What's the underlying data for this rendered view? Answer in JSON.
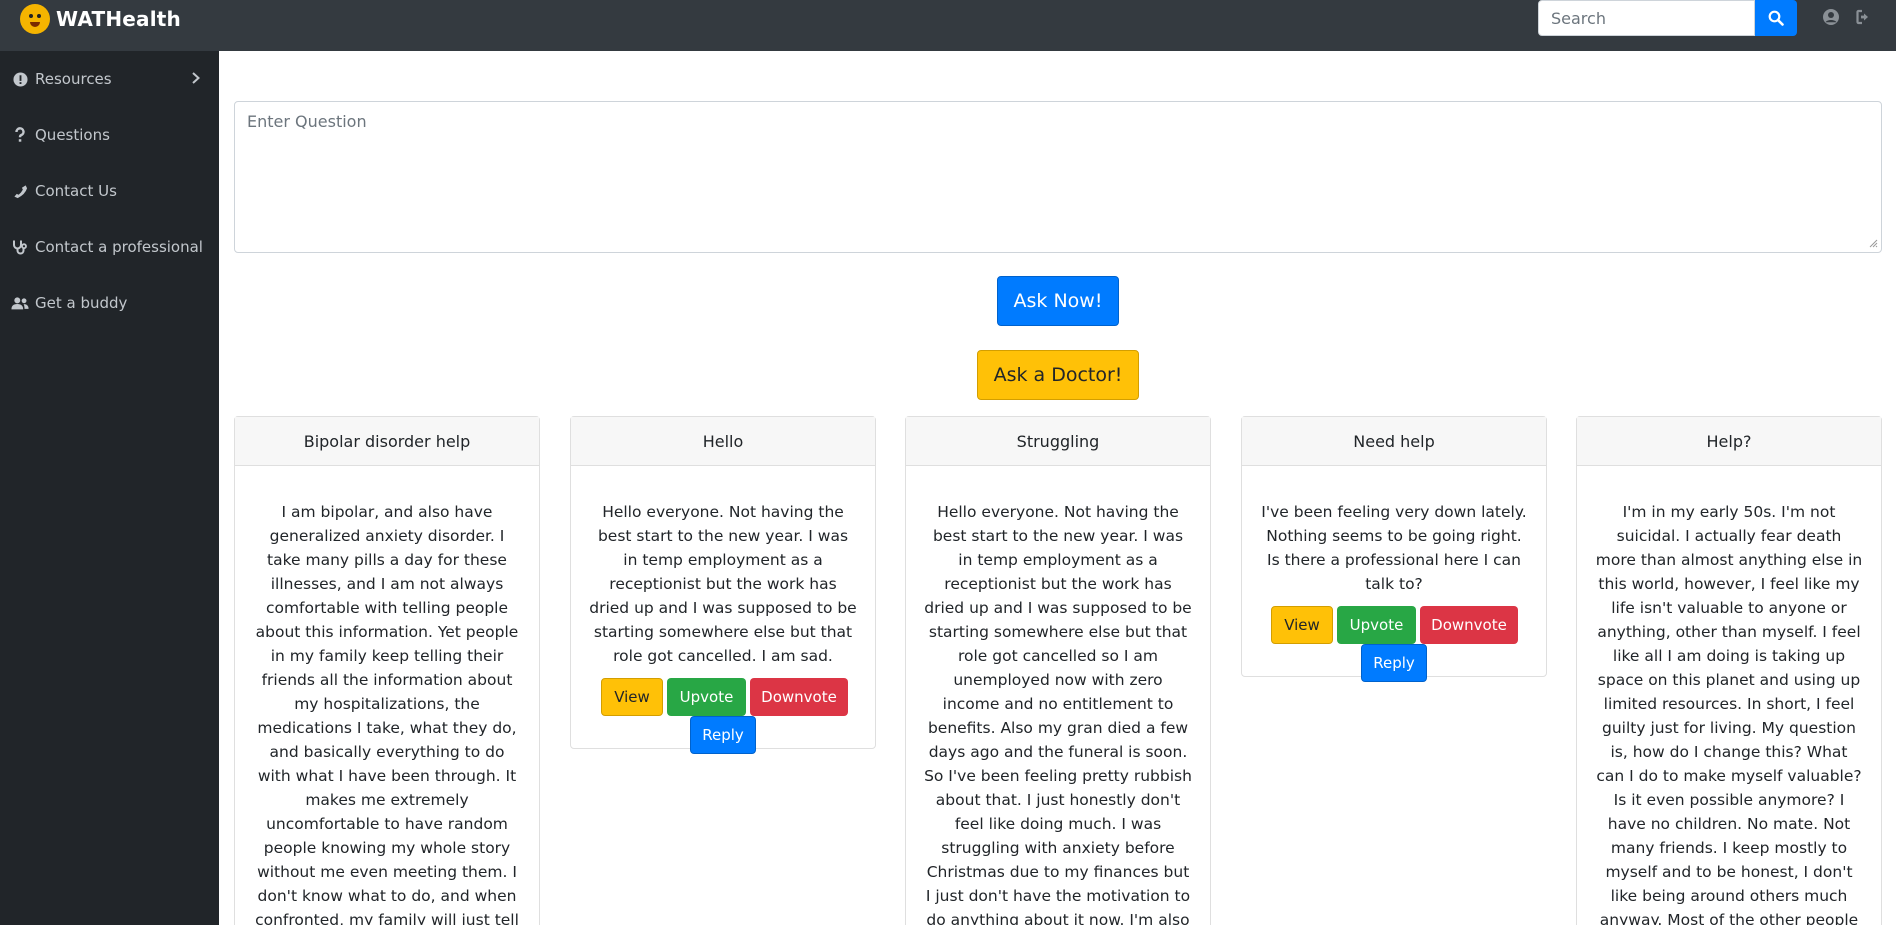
{
  "brand": {
    "name": "WATHealth",
    "logo_icon": "smiley-logo-icon"
  },
  "search": {
    "placeholder": "Search"
  },
  "sidebar": {
    "items": [
      {
        "label": "Resources",
        "icon": "exclamation-circle-icon"
      },
      {
        "label": "Questions",
        "icon": "question-icon"
      },
      {
        "label": "Contact Us",
        "icon": "phone-icon"
      },
      {
        "label": "Contact a professional",
        "icon": "stethoscope-icon"
      },
      {
        "label": "Get a buddy",
        "icon": "users-icon"
      }
    ]
  },
  "question_form": {
    "placeholder": "Enter Question",
    "ask_now_label": "Ask Now!",
    "ask_doctor_label": "Ask a Doctor!"
  },
  "post_actions": {
    "view": "View",
    "upvote": "Upvote",
    "downvote": "Downvote",
    "reply": "Reply"
  },
  "posts": [
    {
      "title": "Bipolar disorder help",
      "body": "I am bipolar, and also have generalized anxiety disorder. I take many pills a day for these illnesses, and I am not always comfortable with telling people about this information. Yet people in my family keep telling their friends all the information about my hospitalizations, the medications I take, what they do, and basically everything to do with what I have been through. It makes me extremely uncomfortable to have random people knowing my whole story without me even meeting them. I don't know what to do, and when confronted, my family will just tell"
    },
    {
      "title": "Hello",
      "body": "Hello everyone. Not having the best start to the new year. I was in temp employment as a receptionist but the work has dried up and I was supposed to be starting somewhere else but that role got cancelled. I am sad."
    },
    {
      "title": "Struggling",
      "body": "Hello everyone. Not having the best start to the new year. I was in temp employment as a receptionist but the work has dried up and I was supposed to be starting somewhere else but that role got cancelled so I am unemployed now with zero income and no entitlement to benefits. Also my gran died a few days ago and the funeral is soon. So I've been feeling pretty rubbish about that. I just honestly don't feel like doing much. I was struggling with anxiety before Christmas due to my finances but I just don't have the motivation to do anything about it now. I'm also studying a"
    },
    {
      "title": "Need help",
      "body": "I've been feeling very down lately. Nothing seems to be going right. Is there a professional here I can talk to?"
    },
    {
      "title": "Help?",
      "body": "I'm in my early 50s. I'm not suicidal. I actually fear death more than almost anything else in this world, however, I feel like my life isn't valuable to anyone or anything, other than myself. I feel like all I am doing is taking up space on this planet and using up limited resources. In short, I feel guilty just for living. My question is, how do I change this? What can I do to make myself valuable? Is it even possible anymore? I have no children. No mate. Not many friends. I keep mostly to myself and to be honest, I don't like being around others much anyway. Most of the other people I'm around are"
    }
  ],
  "colors": {
    "navbar": "#343a40",
    "sidebar": "#212529",
    "primary": "#007bff",
    "warning": "#ffc107",
    "success": "#28a745",
    "danger": "#dc3545"
  }
}
